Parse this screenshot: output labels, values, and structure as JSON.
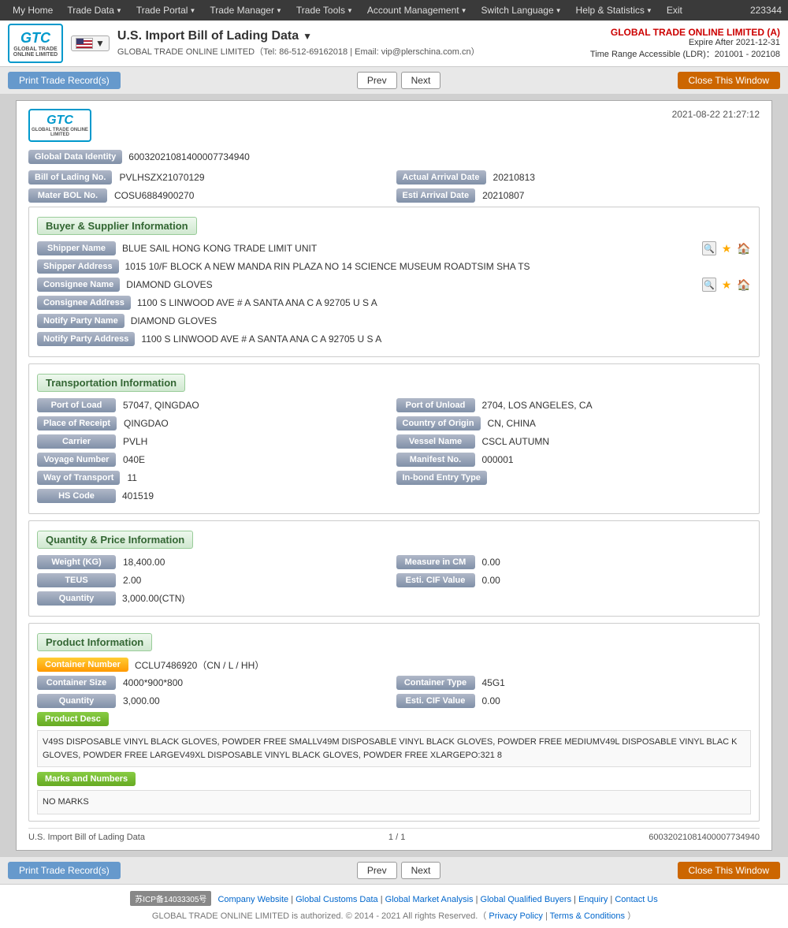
{
  "nav": {
    "items": [
      "My Home",
      "Trade Data",
      "Trade Portal",
      "Trade Manager",
      "Trade Tools",
      "Account Management",
      "Switch Language",
      "Help & Statistics",
      "Exit"
    ],
    "id": "223344"
  },
  "header": {
    "logo_text": "GTC",
    "logo_sub": "GLOBAL TRADE ONLINE LIMITED",
    "flag_alt": "US Flag",
    "title": "U.S. Import Bill of Lading Data",
    "title_arrow": "▼",
    "subtitle": "GLOBAL TRADE ONLINE LIMITED（Tel: 86-512-69162018 | Email: vip@plerschina.com.cn）",
    "company": "GLOBAL TRADE ONLINE LIMITED (A)",
    "expire": "Expire After 2021-12-31",
    "ldr": "Time Range Accessible (LDR)：201001 - 202108"
  },
  "toolbar_top": {
    "print_label": "Print Trade Record(s)",
    "prev_label": "Prev",
    "next_label": "Next",
    "close_label": "Close This Window"
  },
  "toolbar_bottom": {
    "print_label": "Print Trade Record(s)",
    "prev_label": "Prev",
    "next_label": "Next",
    "close_label": "Close This Window"
  },
  "record": {
    "datetime": "2021-08-22 21:27:12",
    "global_data_identity_label": "Global Data Identity",
    "global_data_identity_value": "60032021081400007734940",
    "bill_of_lading_no_label": "Bill of Lading No.",
    "bill_of_lading_no_value": "PVLHSZX21070129",
    "actual_arrival_date_label": "Actual Arrival Date",
    "actual_arrival_date_value": "20210813",
    "mater_bol_no_label": "Mater BOL No.",
    "mater_bol_no_value": "COSU6884900270",
    "esti_arrival_date_label": "Esti Arrival Date",
    "esti_arrival_date_value": "20210807",
    "buyer_supplier_section": "Buyer & Supplier Information",
    "shipper_name_label": "Shipper Name",
    "shipper_name_value": "BLUE SAIL HONG KONG TRADE LIMIT UNIT",
    "shipper_address_label": "Shipper Address",
    "shipper_address_value": "1015 10/F BLOCK A NEW MANDA RIN PLAZA NO 14 SCIENCE MUSEUM ROADTSIM SHA TS",
    "consignee_name_label": "Consignee Name",
    "consignee_name_value": "DIAMOND GLOVES",
    "consignee_address_label": "Consignee Address",
    "consignee_address_value": "1100 S LINWOOD AVE # A SANTA ANA C A 92705 U S A",
    "notify_party_name_label": "Notify Party Name",
    "notify_party_name_value": "DIAMOND GLOVES",
    "notify_party_address_label": "Notify Party Address",
    "notify_party_address_value": "1100 S LINWOOD AVE # A SANTA ANA C A 92705 U S A",
    "transportation_section": "Transportation Information",
    "port_of_load_label": "Port of Load",
    "port_of_load_value": "57047, QINGDAO",
    "port_of_unload_label": "Port of Unload",
    "port_of_unload_value": "2704, LOS ANGELES, CA",
    "place_of_receipt_label": "Place of Receipt",
    "place_of_receipt_value": "QINGDAO",
    "country_of_origin_label": "Country of Origin",
    "country_of_origin_value": "CN, CHINA",
    "carrier_label": "Carrier",
    "carrier_value": "PVLH",
    "vessel_name_label": "Vessel Name",
    "vessel_name_value": "CSCL AUTUMN",
    "voyage_number_label": "Voyage Number",
    "voyage_number_value": "040E",
    "manifest_no_label": "Manifest No.",
    "manifest_no_value": "000001",
    "way_of_transport_label": "Way of Transport",
    "way_of_transport_value": "11",
    "inbond_entry_type_label": "In-bond Entry Type",
    "inbond_entry_type_value": "",
    "hs_code_label": "HS Code",
    "hs_code_value": "401519",
    "quantity_price_section": "Quantity & Price Information",
    "weight_kg_label": "Weight (KG)",
    "weight_kg_value": "18,400.00",
    "measure_in_cm_label": "Measure in CM",
    "measure_in_cm_value": "0.00",
    "teus_label": "TEUS",
    "teus_value": "2.00",
    "esti_cif_value_label": "Esti. CIF Value",
    "esti_cif_value_value": "0.00",
    "quantity_label": "Quantity",
    "quantity_value": "3,000.00(CTN)",
    "product_section": "Product Information",
    "container_number_label": "Container Number",
    "container_number_value": "CCLU7486920（CN / L / HH）",
    "container_size_label": "Container Size",
    "container_size_value": "4000*900*800",
    "container_type_label": "Container Type",
    "container_type_value": "45G1",
    "product_quantity_label": "Quantity",
    "product_quantity_value": "3,000.00",
    "product_esti_cif_label": "Esti. CIF Value",
    "product_esti_cif_value": "0.00",
    "product_desc_label": "Product Desc",
    "product_desc_text": "V49S DISPOSABLE VINYL BLACK GLOVES, POWDER FREE SMALLV49M DISPOSABLE VINYL BLACK GLOVES, POWDER FREE MEDIUMV49L DISPOSABLE VINYL BLAC K GLOVES, POWDER FREE LARGEV49XL DISPOSABLE VINYL BLACK GLOVES, POWDER FREE XLARGEPO:321 8",
    "marks_numbers_label": "Marks and Numbers",
    "marks_numbers_value": "NO MARKS",
    "footer_title": "U.S. Import Bill of Lading Data",
    "footer_page": "1 / 1",
    "footer_id": "60032021081400007734940"
  },
  "footer": {
    "icp": "苏ICP备14033305号",
    "links": [
      "Company Website",
      "Global Customs Data",
      "Global Market Analysis",
      "Global Qualified Buyers",
      "Enquiry",
      "Contact Us"
    ],
    "separators": [
      "|",
      "|",
      "|",
      "|",
      "|"
    ],
    "copyright": "GLOBAL TRADE ONLINE LIMITED is authorized. © 2014 - 2021 All rights Reserved.（",
    "privacy": "Privacy Policy",
    "separator2": "|",
    "terms": "Terms & Conditions",
    "end": "）"
  }
}
